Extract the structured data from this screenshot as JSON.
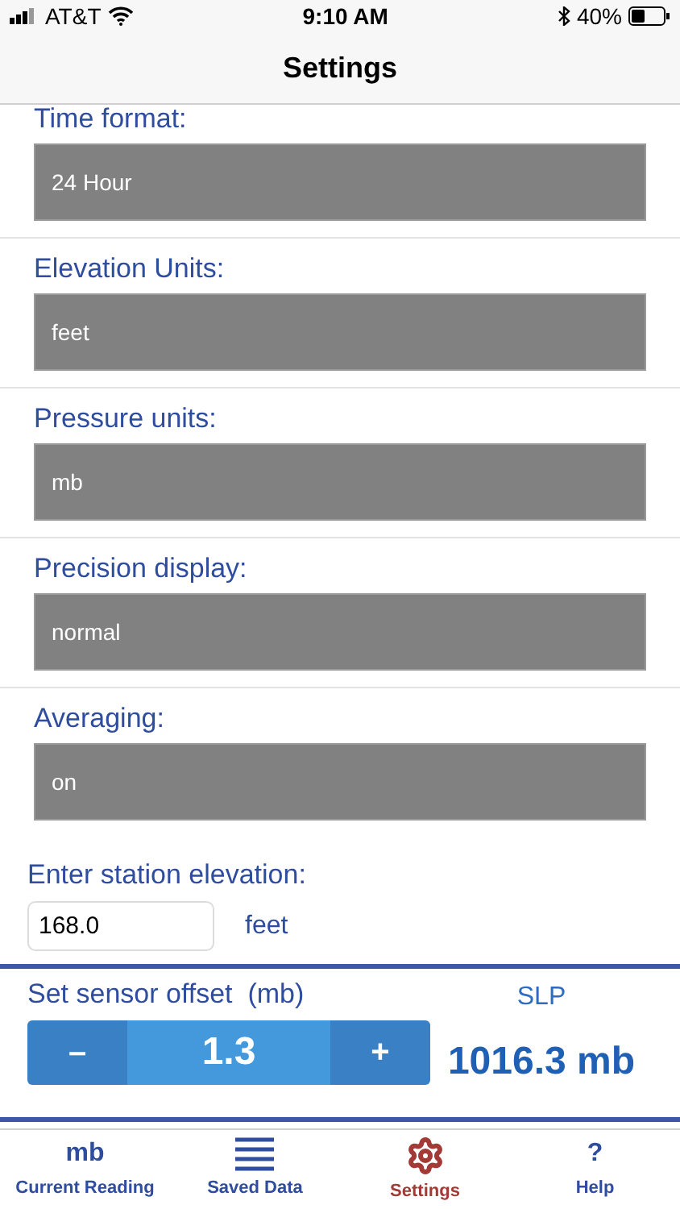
{
  "status_bar": {
    "carrier": "AT&T",
    "time": "9:10 AM",
    "battery": "40%"
  },
  "header": {
    "title": "Settings"
  },
  "settings": [
    {
      "label": "Time format:",
      "value": "24 Hour"
    },
    {
      "label": "Elevation Units:",
      "value": "feet"
    },
    {
      "label": "Pressure units:",
      "value": "mb"
    },
    {
      "label": "Precision display:",
      "value": "normal"
    },
    {
      "label": "Averaging:",
      "value": "on"
    }
  ],
  "elevation": {
    "label": "Enter station elevation:",
    "value": "168.0",
    "unit": "feet"
  },
  "offset": {
    "label": "Set sensor offset  (mb)",
    "minus": "–",
    "value": "1.3",
    "plus": "+",
    "slp_label": "SLP",
    "slp_value": "1016.3 mb"
  },
  "tabs": [
    {
      "label": "Current Reading",
      "kind": "text",
      "glyph": "mb",
      "selected": false
    },
    {
      "label": "Saved Data",
      "kind": "lines",
      "selected": false
    },
    {
      "label": "Settings",
      "kind": "gear",
      "selected": true
    },
    {
      "label": "Help",
      "kind": "text",
      "glyph": "?",
      "selected": false
    }
  ]
}
